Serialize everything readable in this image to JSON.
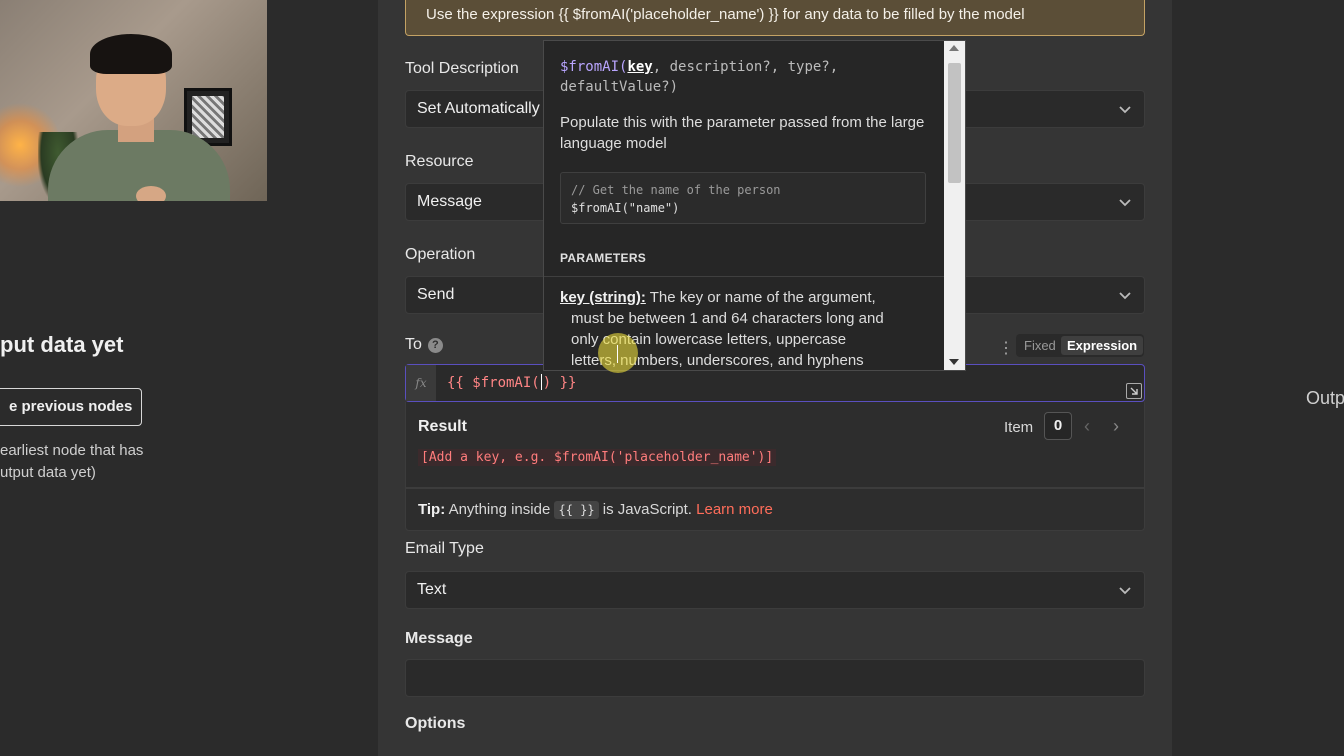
{
  "banner": {
    "text": "Use the expression {{ $fromAI('placeholder_name') }} for any data to be filled by the model"
  },
  "left": {
    "title": "put data yet",
    "button": "e previous nodes",
    "hint_line1": "earliest node that has",
    "hint_line2": "utput data yet)"
  },
  "right": {
    "output_label": "Outp"
  },
  "form": {
    "tool_description": {
      "label": "Tool Description",
      "value": "Set Automatically"
    },
    "resource": {
      "label": "Resource",
      "value": "Message"
    },
    "operation": {
      "label": "Operation",
      "value": "Send"
    },
    "to": {
      "label": "To",
      "help_icon": "?",
      "mode_fixed": "Fixed",
      "mode_expression": "Expression",
      "fx_label": "fx",
      "expr_before_cursor": "{{ $fromAI(",
      "expr_after_cursor": ") }}"
    },
    "result": {
      "title": "Result",
      "item_label": "Item",
      "item_index": "0",
      "value": "[Add a key, e.g. $fromAI('placeholder_name')]"
    },
    "tip": {
      "prefix": "Tip:",
      "text1": "Anything inside",
      "chip": "{{ }}",
      "text2": "is JavaScript.",
      "link": "Learn more"
    },
    "email_type": {
      "label": "Email Type",
      "value": "Text"
    },
    "message": {
      "label": "Message",
      "value": ""
    },
    "options": {
      "label": "Options"
    }
  },
  "popup": {
    "sig_fn": "$fromAI(",
    "sig_key": "key",
    "sig_rest1": ", description?, type?,",
    "sig_rest2": "defaultValue?)",
    "description": "Populate this with the parameter passed from the large language model",
    "example_comment": "// Get the name of the person",
    "example_code": "$fromAI(\"name\")",
    "params_heading": "PARAMETERS",
    "param_name": "key (string):",
    "param_line1": "The key or name of the argument,",
    "param_line2": "must be between 1 and 64 characters long and",
    "param_line3": "only contain lowercase letters, uppercase",
    "param_line4": "letters, numbers, underscores, and hyphens"
  },
  "colors": {
    "accent_link": "#ff6d5a",
    "expression_text": "#ff8585",
    "banner_border": "#c4a264"
  }
}
